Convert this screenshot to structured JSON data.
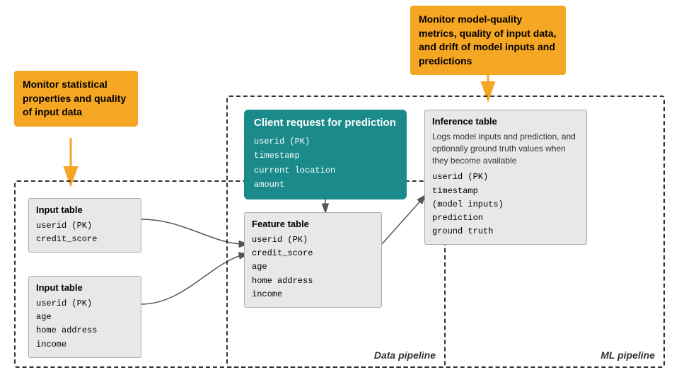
{
  "callouts": {
    "left": {
      "text": "Monitor statistical properties and quality of input data"
    },
    "right": {
      "text": "Monitor model-quality metrics, quality of input data, and drift of model inputs and predictions"
    }
  },
  "client_request": {
    "title": "Client request for prediction",
    "fields": [
      "userid (PK)",
      "timestamp",
      "current location",
      "amount"
    ]
  },
  "input_table_1": {
    "title": "Input table",
    "fields": [
      "userid (PK)",
      "credit_score"
    ]
  },
  "input_table_2": {
    "title": "Input table",
    "fields": [
      "userid (PK)",
      "age",
      "home address",
      "income"
    ]
  },
  "feature_table": {
    "title": "Feature table",
    "fields": [
      "userid (PK)",
      "credit_score",
      "age",
      "home address",
      "income"
    ]
  },
  "inference_table": {
    "title": "Inference table",
    "description": "Logs model inputs and prediction, and optionally ground truth values when they become available",
    "fields": [
      "userid (PK)",
      "timestamp",
      "(model inputs)",
      "prediction",
      "ground truth"
    ]
  },
  "labels": {
    "data_pipeline": "Data pipeline",
    "ml_pipeline": "ML pipeline"
  }
}
